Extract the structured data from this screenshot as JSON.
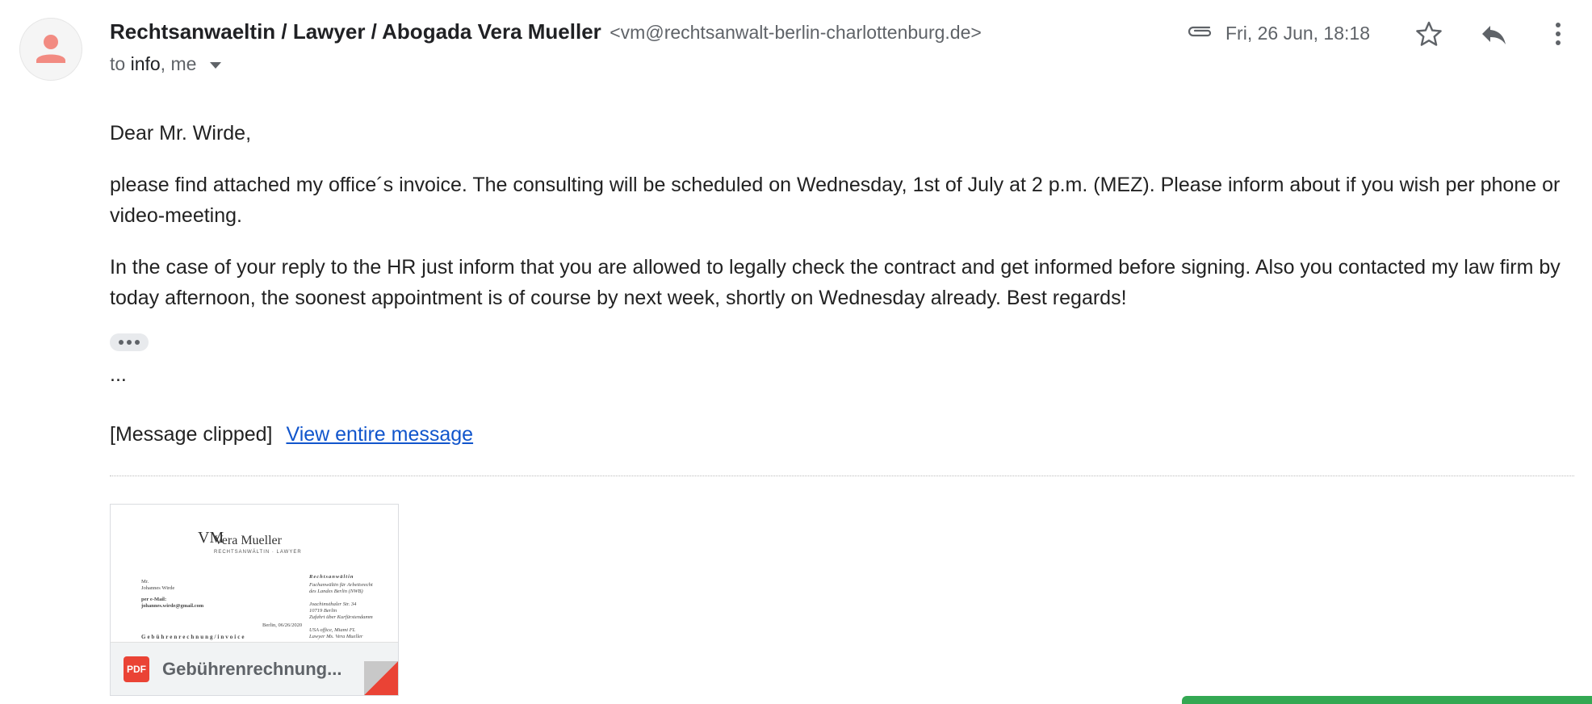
{
  "sender": {
    "name": "Rechtsanwaeltin / Lawyer / Abogada Vera Mueller",
    "email": "<vm@rechtsanwalt-berlin-charlottenburg.de>"
  },
  "recipients": {
    "prefix": "to",
    "primary": "info",
    "rest": ", me"
  },
  "date": "Fri, 26 Jun, 18:18",
  "body": {
    "greeting": "Dear Mr. Wirde,",
    "paragraph1": "please find attached my office´s invoice. The consulting will be scheduled on Wednesday, 1st of July at 2 p.m. (MEZ). Please inform about if you wish per phone or video-meeting.",
    "paragraph2": "In the case of your reply to the HR just inform that you are allowed to legally check the contract and get informed before signing. Also you contacted my law firm by today afternoon, the soonest appointment is of course by next week, shortly on Wednesday already. Best regards!",
    "ellipsis": "...",
    "clipped_label": "[Message clipped]",
    "view_entire_link": "View entire message"
  },
  "attachment": {
    "file_type": "PDF",
    "file_name": "Gebührenrechnung...",
    "preview": {
      "logo_mark": "VM",
      "logo_name": "Vera Mueller",
      "logo_subtitle": "RECHTSANWÄLTIN · LAWYER",
      "recipient_lines": [
        "Mr.",
        "Johannes Wirde"
      ],
      "delivery_label": "per e-Mail:",
      "delivery_email": "johannes.wirde@gmail.com",
      "date_line": "Berlin, 06/26/2020",
      "heading": "Gebührenrechnung/invoice",
      "right_title": "Rechtsanwältin",
      "right_lines": [
        "Fachanwältin für Arbeitsrecht",
        "des Landes Berlin (NWB)",
        "",
        "Joachimsthaler Str. 34",
        "10719 Berlin",
        "Zufahrt über Kurfürstendamm",
        "",
        "USA office, Miami FL",
        "Lawyer Ms. Vera Mueller"
      ]
    }
  },
  "icons": {
    "avatar": "person-icon",
    "attachment": "paperclip-icon",
    "star": "star-icon",
    "reply": "reply-icon",
    "more": "more-vert-icon"
  },
  "colors": {
    "link": "#1155cc",
    "pdf": "#ea4335",
    "avatar_person": "#f28b82"
  }
}
